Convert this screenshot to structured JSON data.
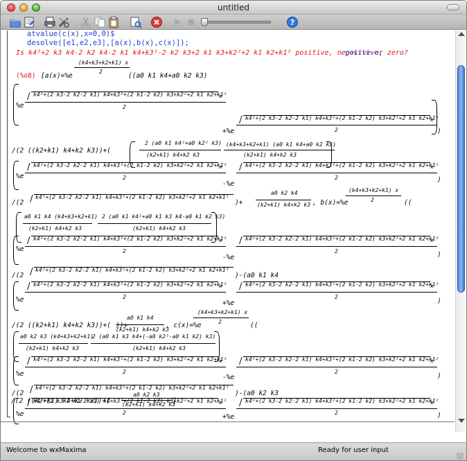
{
  "window": {
    "title": "untitled"
  },
  "toolbar": {
    "icons": [
      "new-document",
      "open-document",
      "print",
      "settings",
      "cut",
      "copy",
      "paste",
      "select-all",
      "stop",
      "play",
      "stop-square",
      "slider",
      "help"
    ]
  },
  "input": {
    "line1": "atvalue(c(x),x=0,0)$",
    "line2": "desolve([e1,e2,e3],[a(x),b(x),c(x)]);",
    "question": "Is  k4²+2 k3 k4-2 k2 k4-2 k1 k4+k3²-2 k2 k3+2 k1 k3+k2²+2 k1 k2+k1²  positive, negative or zero?",
    "answer": "positive;"
  },
  "output": {
    "label": "(%o8)",
    "a_lhs": "[a(x)=%e",
    "exp_num": "(k4+k3+k2+k1) x",
    "two": "2",
    "sqrt_body": "k4²+(2 k3-2 k2-2 k1) k4+k3²+(2 k1-2 k2) k3+k2²+2 k1 k2+k1²",
    "pe": "+%e",
    "me": "-%e",
    "perc_e": "%e",
    "x": "x",
    "cc1": "((a0 k1 k4+a0 k2 k3)",
    "div1": "/(2 ((k2+k1) k4+k2 k3))+(",
    "frac2_num": "2 (a0 k1 k4²+a0 k2² k3)",
    "frac2_den": "(k2+k1) k4+k2 k3",
    "frac3_num": "(k4+k3+k2+k1) (a0 k1 k4+a0 k2 k3)",
    "frac3_den": "(k2+k1) k4+k2 k3",
    "div2": "/(2",
    "tail2": ")+",
    "a0k2k4": "a0 k2 k4",
    "den_k": "(k2+k1) k4+k2 k3",
    "b_lhs": ", b(x)=%e",
    "cc2": "((",
    "b_num1": "a0 k1 k4 (k4+k3+k2+k1)",
    "b_num2": "2 (a0 k1 k4²+a0 k1 k3 k4-a0 k1 k2 k3)",
    "minus_a0k1k4": ")-(a0 k1 k4",
    "plus_close": "))+",
    "a0k1k4": "a0 k1 k4",
    "c_lhs": ", c(x)=%e",
    "c_num1": "a0 k2 k3 (k4+k3+k2+k1)",
    "c_num2": "2 (a0 k1 k3 k4+(-a0 k2²-a0 k1 k2) k3)",
    "minus_a0k2k3": ")-(a0 k2 k3",
    "a0k2k3": "a0 k2 k3",
    "end": "]"
  },
  "status": {
    "left": "Welcome to wxMaxima",
    "right": "Ready for user input"
  },
  "colors": {
    "input": "#1f3fd0",
    "question": "#e0141e",
    "label": "#e0141e",
    "answer": "#1f3fd0"
  }
}
